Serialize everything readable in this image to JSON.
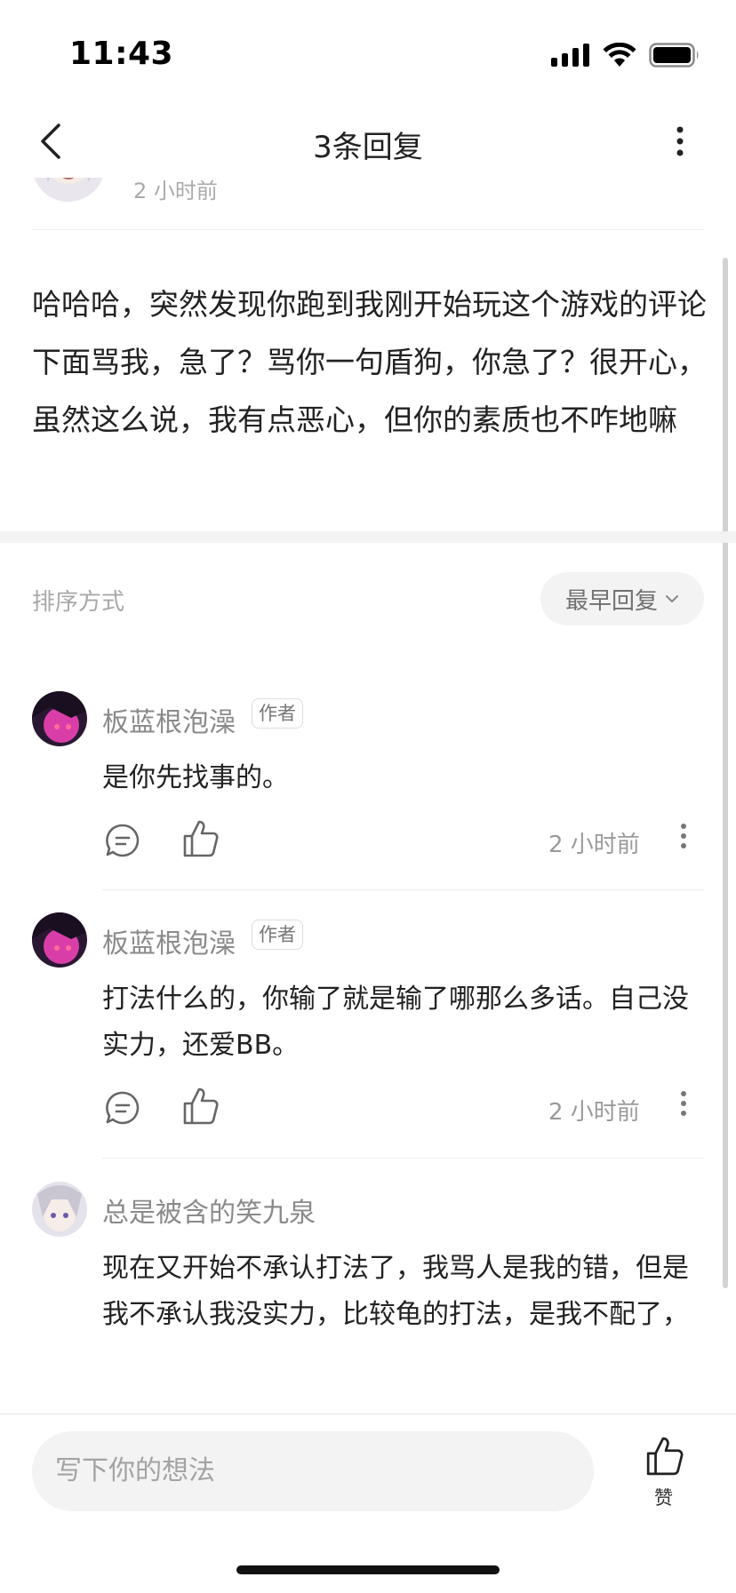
{
  "status_bar": {
    "time": "11:43"
  },
  "nav": {
    "title": "3条回复"
  },
  "original_comment": {
    "time": "2 小时前",
    "text": "哈哈哈，突然发现你跑到我刚开始玩这个游戏的评论下面骂我，急了？骂你一句盾狗，你急了？很开心，虽然这么说，我有点恶心，但你的素质也不咋地嘛"
  },
  "sort": {
    "label": "排序方式",
    "selected": "最早回复"
  },
  "replies": [
    {
      "user": "板蓝根泡澡",
      "badge": "作者",
      "text": "是你先找事的。",
      "time": "2 小时前"
    },
    {
      "user": "板蓝根泡澡",
      "badge": "作者",
      "text": "打法什么的，你输了就是输了哪那么多话。自己没实力，还爱BB。",
      "time": "2 小时前"
    },
    {
      "user": "总是被含的笑九泉",
      "badge": "",
      "text": "现在又开始不承认打法了，我骂人是我的错，但是我不承认我没实力，比较龟的打法，是我不配了，",
      "time": ""
    }
  ],
  "bottom": {
    "input_placeholder": "写下你的想法",
    "like_label": "赞"
  },
  "colors": {
    "accent_gray": "#f3f3f3",
    "text": "#222222",
    "muted": "#9a9a9a"
  }
}
